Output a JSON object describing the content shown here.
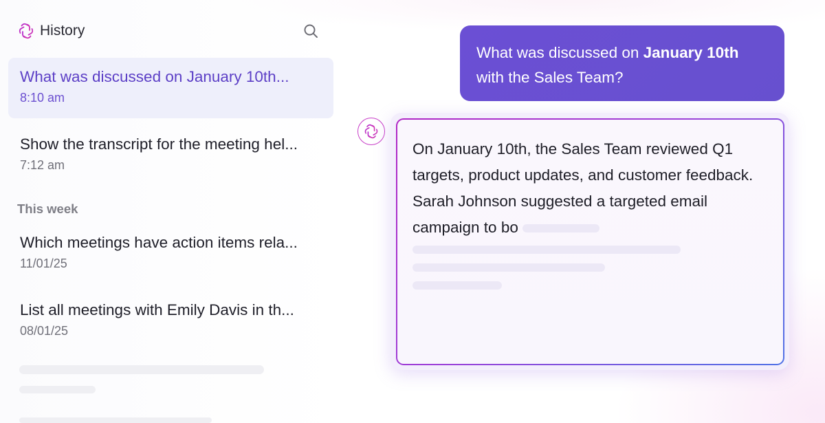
{
  "sidebar": {
    "title": "History",
    "search_icon": "search-icon",
    "brand_icon": "ai-logo-icon",
    "section_label": "This week",
    "items": [
      {
        "title": "What was discussed on January 10th...",
        "time": "8:10 am",
        "active": true
      },
      {
        "title": "Show the transcript for the meeting hel...",
        "time": "7:12 am",
        "active": false
      },
      {
        "title": "Which meetings have action items rela...",
        "time": "11/01/25",
        "active": false
      },
      {
        "title": "List all meetings with Emily Davis in th...",
        "time": "08/01/25",
        "active": false
      }
    ]
  },
  "chat": {
    "user_message": {
      "prefix": "What was discussed on ",
      "bold": "January 10th",
      "suffix": "with the Sales Team?"
    },
    "ai_response": "On January 10th, the Sales Team reviewed Q1 targets, product updates, and customer feedback. Sarah Johnson suggested a targeted email campaign to bo"
  },
  "colors": {
    "accent": "#6a4fd3",
    "active_item_bg": "#eeeffb",
    "avatar_ring": "#c73bc7"
  }
}
